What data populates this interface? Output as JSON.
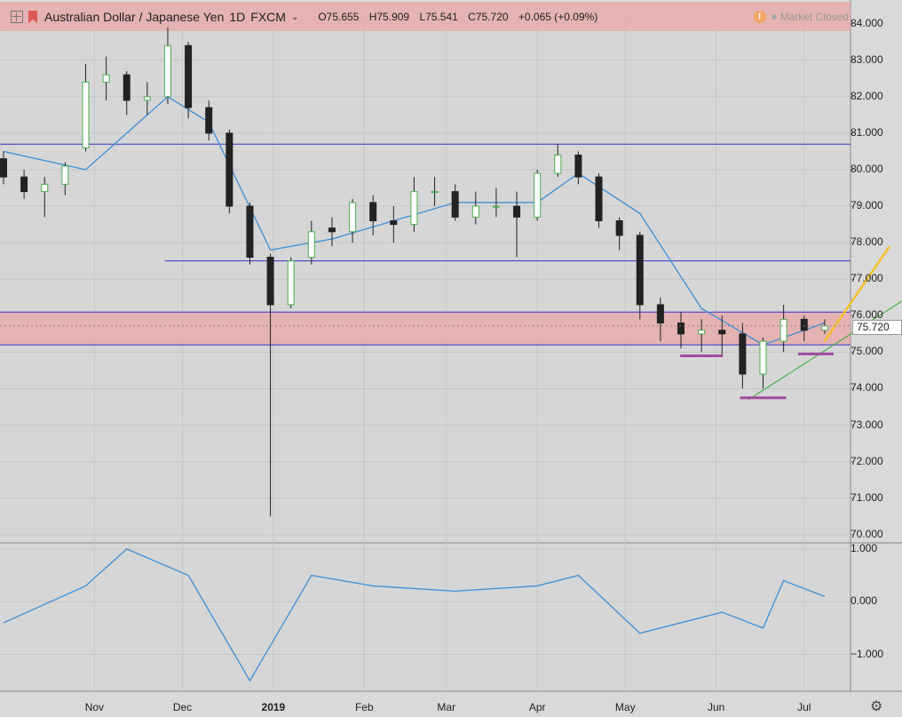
{
  "header": {
    "symbol": "Australian Dollar / Japanese Yen",
    "interval": "1D",
    "exchange": "FXCM",
    "open": "O75.655",
    "high": "H75.909",
    "low": "L75.541",
    "close": "C75.720",
    "change": "+0.065 (+0.09%)",
    "market_status": "Market Closed"
  },
  "price_axis": [
    "84.000",
    "83.000",
    "82.000",
    "81.000",
    "80.000",
    "79.000",
    "78.000",
    "77.000",
    "76.000",
    "75.000",
    "74.000",
    "73.000",
    "72.000",
    "71.000",
    "70.000"
  ],
  "osc_axis": [
    "1.000",
    "0.000",
    "−1.000"
  ],
  "time_axis": [
    "Nov",
    "Dec",
    "2019",
    "Feb",
    "Mar",
    "Apr",
    "May",
    "Jun",
    "Jul"
  ],
  "last_price": "75.720",
  "colors": {
    "up": "#4caf50",
    "down": "#222222",
    "ma": "#3d8fd6",
    "resistance_line": "#3333cc",
    "zone_fill": "#eaa7a7",
    "trendline": "#33aa33",
    "arrow": "#f6c02a",
    "support_mark": "#a04aa0"
  },
  "chart_data": {
    "type": "candlestick",
    "series": [
      {
        "name": "AUD/JPY",
        "note": "approximate weekly OHLC",
        "x": [
          "2018-10-01",
          "2018-10-08",
          "2018-10-15",
          "2018-10-22",
          "2018-10-29",
          "2018-11-05",
          "2018-11-12",
          "2018-11-19",
          "2018-11-26",
          "2018-12-03",
          "2018-12-10",
          "2018-12-17",
          "2018-12-24",
          "2018-12-31",
          "2019-01-07",
          "2019-01-14",
          "2019-01-21",
          "2019-01-28",
          "2019-02-04",
          "2019-02-11",
          "2019-02-18",
          "2019-02-25",
          "2019-03-04",
          "2019-03-11",
          "2019-03-18",
          "2019-03-25",
          "2019-04-01",
          "2019-04-08",
          "2019-04-15",
          "2019-04-22",
          "2019-04-29",
          "2019-05-06",
          "2019-05-13",
          "2019-05-20",
          "2019-05-27",
          "2019-06-03",
          "2019-06-10",
          "2019-06-17",
          "2019-06-24",
          "2019-07-01",
          "2019-07-08"
        ],
        "open": [
          80.3,
          79.8,
          79.4,
          79.6,
          80.6,
          82.4,
          82.6,
          81.9,
          82.0,
          83.4,
          81.7,
          81.0,
          79.0,
          77.6,
          76.3,
          77.6,
          78.4,
          78.3,
          79.1,
          78.6,
          78.5,
          79.4,
          79.4,
          78.7,
          79.0,
          79.0,
          78.7,
          79.9,
          80.4,
          79.8,
          78.6,
          78.2,
          76.3,
          75.8,
          75.5,
          75.6,
          75.5,
          74.4,
          75.3,
          75.9,
          75.6
        ],
        "high": [
          80.5,
          80.0,
          79.8,
          80.2,
          82.9,
          83.1,
          82.7,
          82.4,
          83.9,
          83.5,
          81.9,
          81.1,
          79.1,
          77.7,
          77.6,
          78.6,
          78.7,
          79.2,
          79.3,
          79.0,
          79.8,
          79.8,
          79.6,
          79.4,
          79.5,
          79.4,
          80.0,
          80.7,
          80.5,
          79.9,
          78.7,
          78.3,
          76.5,
          76.1,
          75.9,
          76.0,
          75.8,
          75.4,
          76.3,
          76.0,
          75.9
        ],
        "low": [
          79.6,
          79.2,
          78.7,
          79.3,
          80.5,
          81.9,
          81.5,
          81.5,
          81.8,
          81.4,
          80.8,
          78.8,
          77.4,
          70.5,
          76.2,
          77.4,
          77.9,
          78.0,
          78.2,
          78.0,
          78.3,
          79.0,
          78.6,
          78.5,
          78.7,
          77.6,
          78.6,
          79.8,
          79.6,
          78.4,
          77.8,
          75.9,
          75.3,
          75.1,
          75.0,
          74.9,
          74.0,
          74.0,
          75.0,
          75.3,
          75.5
        ],
        "close": [
          79.8,
          79.4,
          79.6,
          80.1,
          82.4,
          82.6,
          81.9,
          82.0,
          83.4,
          81.7,
          81.0,
          79.0,
          77.6,
          76.3,
          77.5,
          78.3,
          78.3,
          79.1,
          78.6,
          78.5,
          79.4,
          79.4,
          78.7,
          79.0,
          79.0,
          78.7,
          79.9,
          80.4,
          79.8,
          78.6,
          78.2,
          76.3,
          75.8,
          75.5,
          75.6,
          75.5,
          74.4,
          75.3,
          75.9,
          75.6,
          75.72
        ]
      }
    ],
    "moving_average": {
      "name": "MA",
      "x": [
        "2018-10-01",
        "2018-10-29",
        "2018-11-26",
        "2018-12-10",
        "2018-12-31",
        "2019-01-21",
        "2019-02-11",
        "2019-03-04",
        "2019-04-01",
        "2019-04-15",
        "2019-05-06",
        "2019-05-27",
        "2019-06-17",
        "2019-07-08"
      ],
      "values": [
        80.5,
        80.0,
        82.0,
        81.3,
        77.8,
        78.1,
        78.6,
        79.1,
        79.1,
        79.9,
        78.8,
        76.2,
        75.2,
        75.8
      ]
    },
    "oscillator": {
      "x": [
        "2018-10-01",
        "2018-10-29",
        "2018-11-12",
        "2018-12-03",
        "2018-12-24",
        "2019-01-14",
        "2019-02-04",
        "2019-03-04",
        "2019-04-01",
        "2019-04-15",
        "2019-05-06",
        "2019-06-03",
        "2019-06-17",
        "2019-06-24",
        "2019-07-08"
      ],
      "values": [
        -0.4,
        0.3,
        1.0,
        0.5,
        -1.5,
        0.5,
        0.3,
        0.2,
        0.3,
        0.5,
        -0.6,
        -0.2,
        -0.5,
        0.4,
        0.1
      ]
    },
    "horizontal_lines": [
      80.7,
      77.5,
      75.2,
      76.1
    ],
    "zones": [
      [
        75.2,
        76.1
      ],
      [
        83.8,
        84.6
      ]
    ],
    "ylim": [
      69.8,
      84.6
    ],
    "osc_ylim": [
      -1.7,
      1.1
    ]
  }
}
